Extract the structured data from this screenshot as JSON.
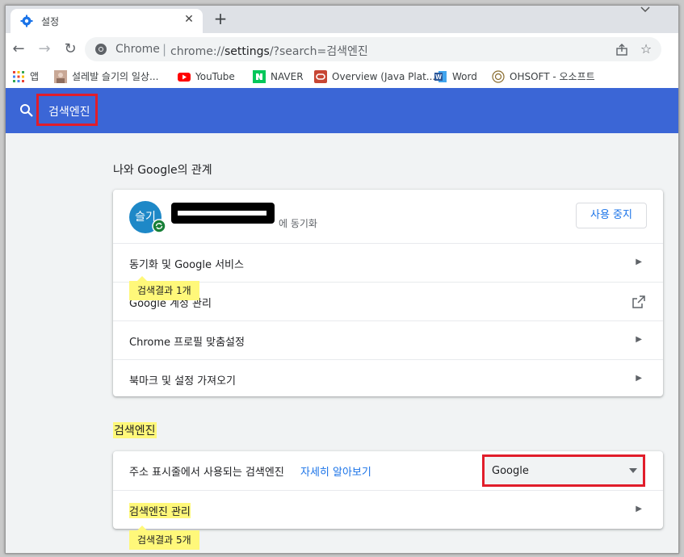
{
  "tab": {
    "title": "설정",
    "close": "✕",
    "new_tab": "+"
  },
  "toolbar": {
    "back": "←",
    "forward": "→",
    "reload": "↻",
    "chrome_label": "Chrome",
    "separator": "|",
    "url_prefix": "chrome://",
    "url_host": "settings",
    "url_rest": "/?search=검색엔진",
    "share_icon": "share-icon",
    "star": "☆"
  },
  "bookmarks": [
    {
      "label": "앱",
      "icon": "apps-grid-icon"
    },
    {
      "label": "설레발 슬기의 일상...",
      "icon": "blog-avatar-icon"
    },
    {
      "label": "YouTube",
      "icon": "youtube-icon",
      "color": "#ff0000"
    },
    {
      "label": "NAVER",
      "icon": "naver-icon",
      "color": "#03c75a"
    },
    {
      "label": "Overview (Java Plat...",
      "icon": "oracle-icon",
      "color": "#c74634"
    },
    {
      "label": "Word",
      "icon": "word-icon",
      "color": "#2b579a"
    },
    {
      "label": "OHSOFT - 오소프트",
      "icon": "ohsoft-icon"
    }
  ],
  "header": {
    "query": "검색엔진"
  },
  "you_and_google": {
    "title": "나와 Google의 관계",
    "avatar_text": "슬기",
    "account_suffix": "에 동기화",
    "stop_button": "사용 중지",
    "rows": [
      {
        "label": "동기화 및 Google 서비스"
      },
      {
        "label": "Google 계정 관리"
      },
      {
        "label": "Chrome 프로필 맞춤설정"
      },
      {
        "label": "북마크 및 설정 가져오기"
      }
    ],
    "tooltip": "검색결과 1개"
  },
  "search_engine": {
    "title": "검색엔진",
    "row1_label": "주소 표시줄에서 사용되는 검색엔진",
    "learn_more": "자세히 알아보기",
    "select_value": "Google",
    "row2_label": "검색엔진 관리",
    "tooltip": "검색결과 5개"
  },
  "colors": {
    "accent": "#3b66d6",
    "link": "#1a73e8",
    "highlight": "#fff87a",
    "annotation": "#e11d2a"
  }
}
